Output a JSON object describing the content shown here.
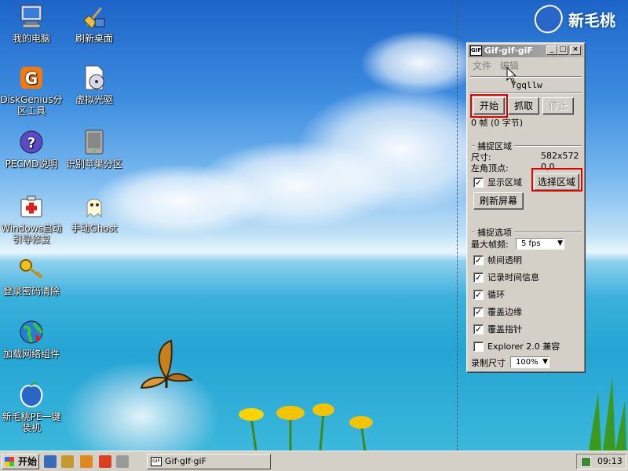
{
  "desktop": {
    "brand": "新毛桃",
    "icons": [
      {
        "label": "我的电脑"
      },
      {
        "label": "刷新桌面"
      },
      {
        "label": "DiskGenius分区工具"
      },
      {
        "label": "虚拟光驱"
      },
      {
        "label": "PECMD说明"
      },
      {
        "label": "识别苹果分区"
      },
      {
        "label": "Windows启动引导修复"
      },
      {
        "label": "手动Ghost"
      },
      {
        "label": "登录密码清除"
      },
      {
        "label": "加载网络组件"
      },
      {
        "label": "新毛桃PE一键装机"
      }
    ]
  },
  "window": {
    "title": "Gif·gIf·giF",
    "icon_text": "GIF",
    "menu": [
      "文件",
      "编辑"
    ],
    "filename": "Ygqllw",
    "buttons": {
      "start": "开始",
      "capture": "抓取",
      "stop": "停止"
    },
    "frames_info": "0 帧 (0 字节)",
    "capture_area": {
      "group": "捕捉区域",
      "size_label": "尺寸:",
      "size_value": "582x572",
      "topleft_label": "左角顶点:",
      "topleft_value": "0,0",
      "show_area": "显示区域",
      "select_area": "选择区域",
      "refresh_screen": "刷新屏幕"
    },
    "capture_options": {
      "group": "捕捉选项",
      "max_fps_label": "最大帧频:",
      "max_fps_value": "5 fps",
      "options": [
        {
          "label": "帧间透明",
          "checked": true
        },
        {
          "label": "记录时间信息",
          "checked": true
        },
        {
          "label": "循环",
          "checked": true
        },
        {
          "label": "覆盖边缘",
          "checked": true
        },
        {
          "label": "覆盖指针",
          "checked": true
        },
        {
          "label": "Explorer 2.0 兼容",
          "checked": false
        }
      ],
      "record_size_label": "录制尺寸",
      "record_size_value": "100%"
    }
  },
  "taskbar": {
    "start_label": "开始",
    "task_title": "Gif·gIf·giF",
    "clock": "09:13"
  },
  "colors": {
    "highlight_box": "#e00000",
    "window_face": "#d4d0c8"
  }
}
